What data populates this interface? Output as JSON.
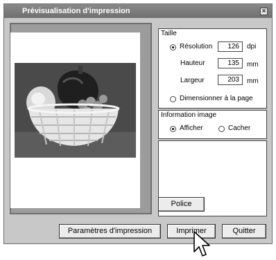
{
  "window": {
    "title": "Prévisualisation d'impression",
    "close_icon": "close-icon"
  },
  "size_group": {
    "title": "Taille",
    "resolution": {
      "label": "Résolution",
      "value": "126",
      "unit": "dpi",
      "selected": true
    },
    "height": {
      "label": "Hauteur",
      "value": "135",
      "unit": "mm"
    },
    "width": {
      "label": "Largeur",
      "value": "203",
      "unit": "mm"
    },
    "fit_to_page": {
      "label": "Dimensionner à la page",
      "selected": false
    }
  },
  "image_info_group": {
    "title": "Information image",
    "show": {
      "label": "Afficher",
      "selected": true
    },
    "hide": {
      "label": "Cacher",
      "selected": false
    }
  },
  "buttons": {
    "font": "Police",
    "print_settings": "Paramètres d'impression",
    "print": "Imprimer",
    "quit": "Quitter"
  },
  "cursor_icon": "mouse-pointer-icon"
}
